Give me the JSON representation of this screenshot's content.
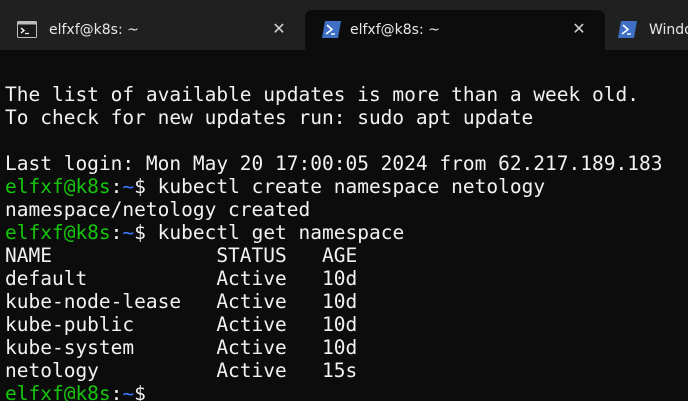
{
  "tabs": [
    {
      "title": "elfxf@k8s: ~",
      "close": "✕",
      "icon": "terminal-icon"
    },
    {
      "title": "elfxf@k8s: ~",
      "close": "✕",
      "icon": "powershell-icon"
    },
    {
      "title": "Windo",
      "icon": "powershell-icon"
    }
  ],
  "colors": {
    "user": "#16c60c",
    "path": "#3b78ff",
    "text": "#f2f2f2",
    "background": "#0c0c0c"
  },
  "prompt": {
    "user": "elfxf@k8s",
    "sep": ":",
    "path": "~",
    "symbol": "$"
  },
  "terminal": {
    "line1": "The list of available updates is more than a week old.",
    "line2": "To check for new updates run: sudo apt update",
    "line3": "Last login: Mon May 20 17:00:05 2024 from 62.217.189.183",
    "cmd1": " kubectl create namespace netology",
    "output1": "namespace/netology created",
    "cmd2": " kubectl get namespace",
    "table": {
      "header": "NAME              STATUS   AGE",
      "rows": [
        "default           Active   10d",
        "kube-node-lease   Active   10d",
        "kube-public       Active   10d",
        "kube-system       Active   10d",
        "netology          Active   15s"
      ]
    }
  }
}
